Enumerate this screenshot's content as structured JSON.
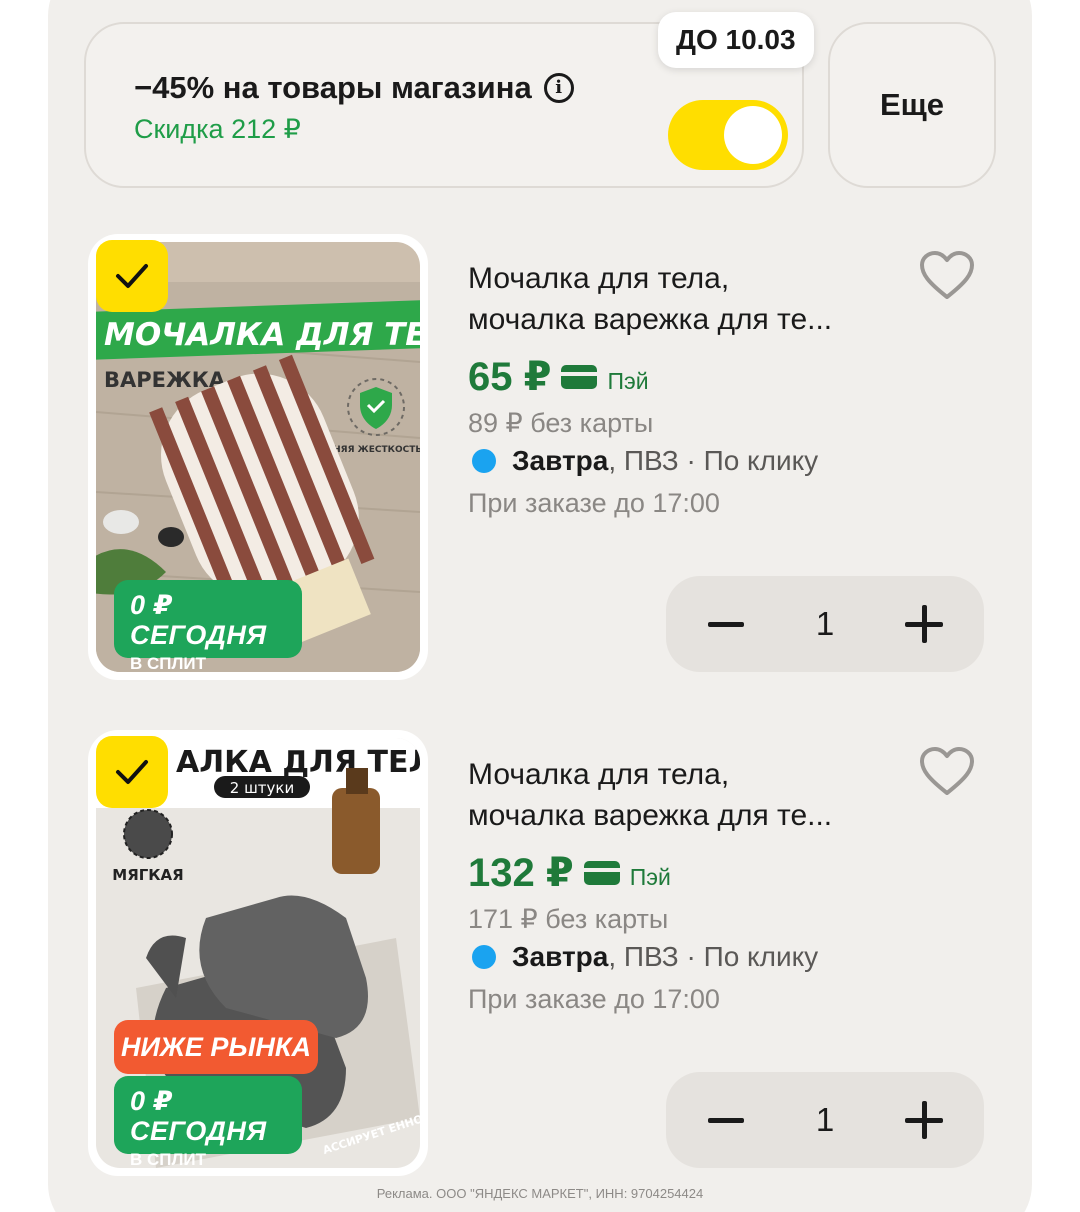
{
  "promo": {
    "title": "−45% на товары магазина",
    "info_icon": "info-icon",
    "discount": "Скидка 212 ₽",
    "deadline": "ДО 10.03",
    "toggle_on": true,
    "more_label": "Еще"
  },
  "products": [
    {
      "selected": true,
      "image_heading": "МОЧАЛКА ДЛЯ ТЕЛА",
      "image_subheading": "ВАРЕЖКА",
      "image_note": "СРЕДНЯЯ ЖЕСТКОСТЬ",
      "split_big": "0 ₽ СЕГОДНЯ",
      "split_small": "В СПЛИТ",
      "title_line1": "Мочалка для тела,",
      "title_line2": "мочалка варежка для те...",
      "price": "65 ₽",
      "pay_label": "Пэй",
      "old_price": "89 ₽ без карты",
      "delivery_day": "Завтра",
      "delivery_rest": ", ПВЗ · По клику",
      "order_note": "При заказе до 17:00",
      "quantity": "1"
    },
    {
      "selected": true,
      "image_heading": "АЛКА ДЛЯ ТЕЛА",
      "image_subheading": "2 штуки",
      "image_note": "МЯГКАЯ",
      "image_corner": "АССИРУЕТ ЕННО",
      "low_price_badge": "НИЖЕ РЫНКА",
      "split_big": "0 ₽ СЕГОДНЯ",
      "split_small": "В СПЛИТ",
      "title_line1": "Мочалка для тела,",
      "title_line2": "мочалка варежка для те...",
      "price": "132 ₽",
      "pay_label": "Пэй",
      "old_price": "171 ₽ без карты",
      "delivery_day": "Завтра",
      "delivery_rest": ", ПВЗ · По клику",
      "order_note": "При заказе до 17:00",
      "quantity": "1"
    }
  ],
  "ad_footer": "Реклама. ООО \"ЯНДЕКС МАРКЕТ\", ИНН: 9704254424",
  "colors": {
    "accent_yellow": "#ffde00",
    "price_green": "#1f7a3a",
    "discount_green": "#1f9d48",
    "split_green": "#1ea55a",
    "low_price_orange": "#f25a31",
    "delivery_dot": "#1aa3f0",
    "background": "#f1efec"
  }
}
